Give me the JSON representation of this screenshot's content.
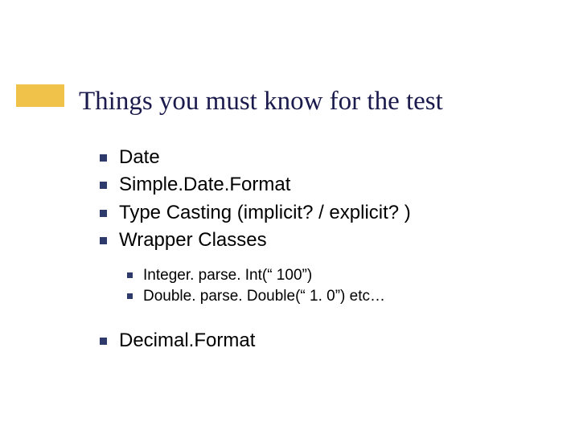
{
  "title": "Things you must know for the test",
  "items": {
    "i0": "Date",
    "i1": "Simple.Date.Format",
    "i2": "Type Casting (implicit? / explicit? )",
    "i3": "Wrapper Classes",
    "sub": {
      "s0": "Integer. parse. Int(“ 100”)",
      "s1": "Double. parse. Double(“ 1. 0”) etc…"
    },
    "i4": "Decimal.Format"
  }
}
